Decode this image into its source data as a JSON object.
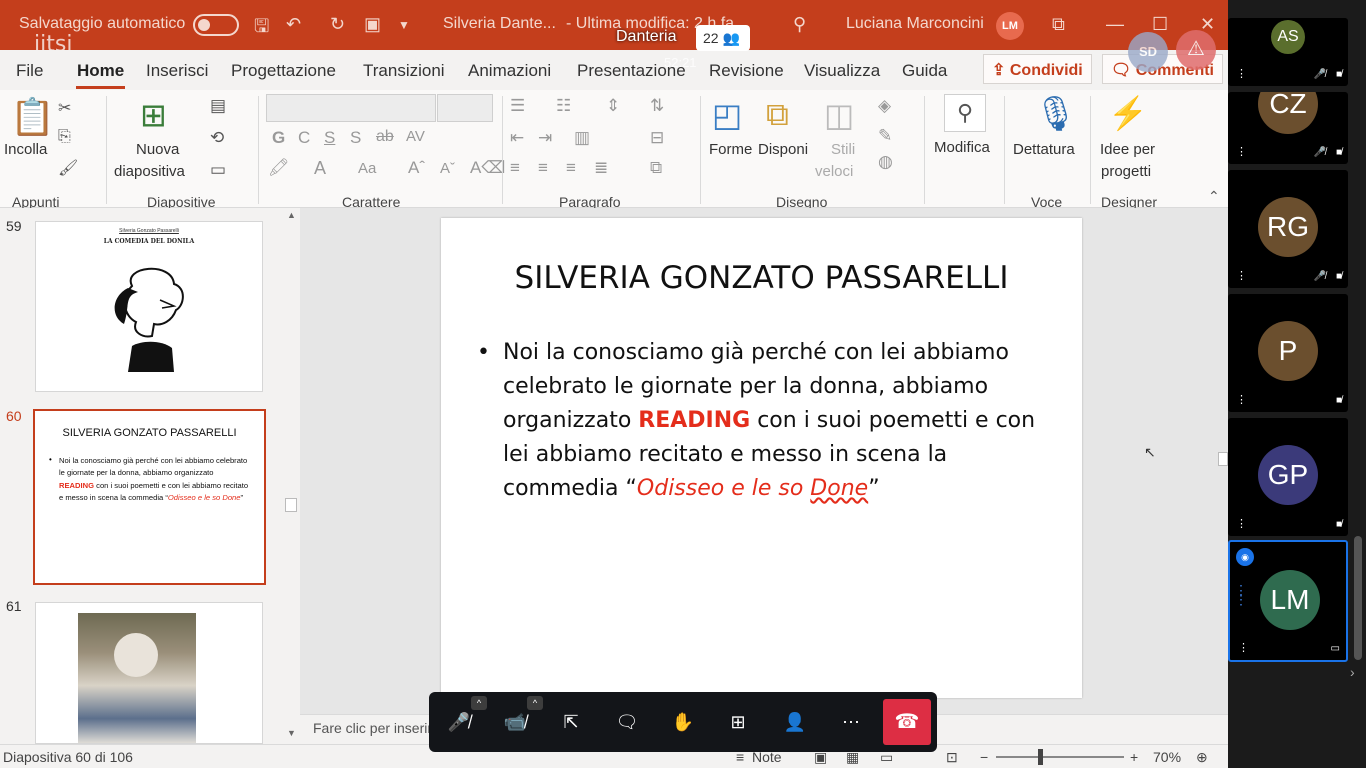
{
  "titlebar": {
    "autosave_label": "Salvataggio automatico",
    "doc_title": "Silveria Dante...",
    "modified": "- Ultima modifica: 2 h fa",
    "user_name": "Luciana Marconcini",
    "user_initials": "LM",
    "jitsi_logo": "jitsi"
  },
  "tabs": [
    "File",
    "Home",
    "Inserisci",
    "Progettazione",
    "Transizioni",
    "Animazioni",
    "Presentazione",
    "Revisione",
    "Visualizza",
    "Guida"
  ],
  "share_label": "Condividi",
  "comments_label": "Commenti",
  "ribbon": {
    "paste": "Incolla",
    "new_slide": [
      "Nuova",
      "diapositiva"
    ],
    "shapes": "Forme",
    "arrange": "Disponi",
    "quick_styles": [
      "Stili",
      "veloci"
    ],
    "edit": "Modifica",
    "dictate": "Dettatura",
    "design_ideas": [
      "Idee per",
      "progetti"
    ],
    "groups": [
      "Appunti",
      "Diapositive",
      "Carattere",
      "Paragrafo",
      "Disegno",
      "Voce",
      "Designer"
    ]
  },
  "thumbs": {
    "n59": "59",
    "n60": "60",
    "n61": "61",
    "t59_small": "Silveria Gonzato Passarelli",
    "t59_title": "LA COMEDIA DEL DONILA",
    "t60_title": "SILVERIA GONZATO PASSARELLI",
    "t60_b1": "Noi la conosciamo già perché con lei abbiamo celebrato le giornate per la donna, abbiamo organizzato ",
    "t60_b2": "READING",
    "t60_b3": " con i suoi poemetti e con lei abbiamo recitato e messo in scena la commedia “",
    "t60_b4": "Odisseo e le so Done",
    "t60_b5": "”"
  },
  "slide": {
    "title": "SILVERIA GONZATO PASSARELLI",
    "bullet": "•",
    "p1": "Noi la conosciamo già perché con lei abbiamo celebrato le giornate per la donna, abbiamo organizzato ",
    "p2": "READING",
    "p3": " con i suoi poemetti e con lei abbiamo recitato e messo in scena la commedia “",
    "p4": "Odisseo e le so ",
    "p5": "Done",
    "p6": "”"
  },
  "notes_placeholder": "Fare clic per inserire note",
  "status": {
    "slide_info": "Diapositiva 60 di 106",
    "notes": "Note",
    "zoom": "70%"
  },
  "jitsi": {
    "meeting": "Danteria",
    "participants": "22",
    "timer": "52:21",
    "sd_initials": "SD"
  },
  "filmstrip": [
    {
      "initials": "AS",
      "color": "#5a6e2d"
    },
    {
      "initials": "CZ",
      "color": "#6b4f2e"
    },
    {
      "initials": "RG",
      "color": "#6b4f2e"
    },
    {
      "initials": "P",
      "color": "#6b4f2e"
    },
    {
      "initials": "GP",
      "color": "#3b3a7a"
    },
    {
      "initials": "LM",
      "color": "#2f6b4f"
    }
  ],
  "colors": {
    "accent": "#c43e1c",
    "reading": "#e42d1b",
    "hangup": "#dd2e44"
  }
}
